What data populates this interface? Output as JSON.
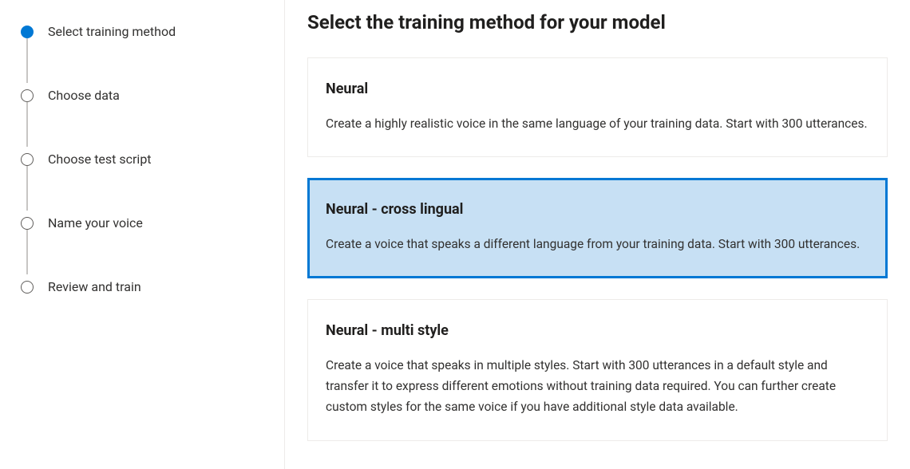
{
  "sidebar": {
    "steps": [
      {
        "label": "Select training method",
        "state": "current"
      },
      {
        "label": "Choose data",
        "state": "upcoming"
      },
      {
        "label": "Choose test script",
        "state": "upcoming"
      },
      {
        "label": "Name your voice",
        "state": "upcoming"
      },
      {
        "label": "Review and train",
        "state": "upcoming"
      }
    ]
  },
  "main": {
    "title": "Select the training method for your model",
    "options": [
      {
        "title": "Neural",
        "description": "Create a highly realistic voice in the same language of your training data. Start with 300 utterances.",
        "selected": false
      },
      {
        "title": "Neural - cross lingual",
        "description": "Create a voice that speaks a different language from your training data. Start with 300 utterances.",
        "selected": true
      },
      {
        "title": "Neural - multi style",
        "description": "Create a voice that speaks in multiple styles. Start with 300 utterances in a default style and transfer it to express different emotions without training data required. You can further create custom styles for the same voice if you have additional style data available.",
        "selected": false
      }
    ]
  }
}
